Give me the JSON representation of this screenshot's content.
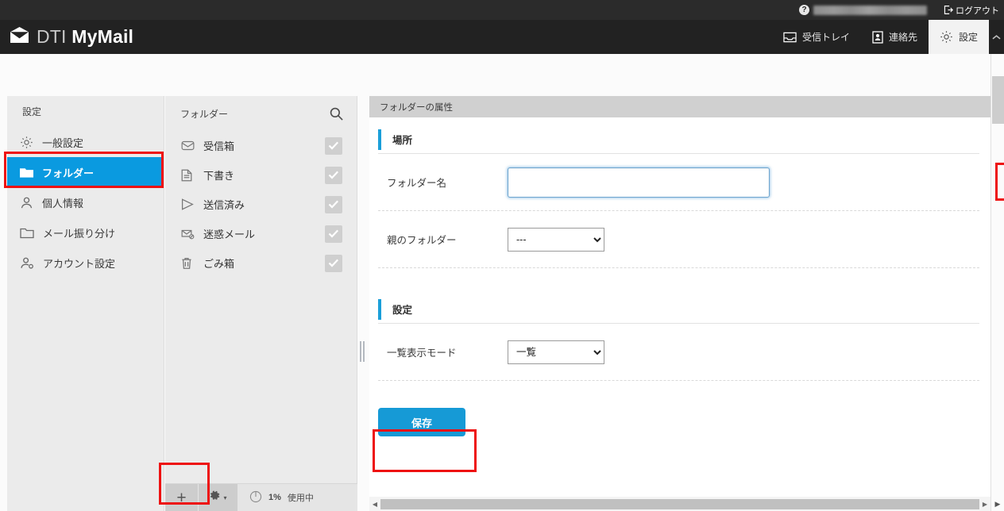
{
  "topbar": {
    "help_icon": "help-circle-icon",
    "user_email": "",
    "logout_label": "ログアウト",
    "logout_icon": "logout-icon"
  },
  "navbar": {
    "brand_icon": "envelope-icon",
    "brand_dti": "DTI",
    "brand_mymail": "MyMail",
    "items": [
      {
        "label": "受信トレイ",
        "icon": "inbox-icon",
        "active": false
      },
      {
        "label": "連絡先",
        "icon": "contacts-icon",
        "active": false
      },
      {
        "label": "設定",
        "icon": "gear-icon",
        "active": true
      }
    ],
    "collapse_icon": "chevron-up-icon"
  },
  "sidebar": {
    "title": "設定",
    "items": [
      {
        "label": "一般設定",
        "icon": "gear-icon",
        "selected": false
      },
      {
        "label": "フォルダー",
        "icon": "folder-filled-icon",
        "selected": true
      },
      {
        "label": "個人情報",
        "icon": "user-icon",
        "selected": false
      },
      {
        "label": "メール振り分け",
        "icon": "folder-outline-icon",
        "selected": false
      },
      {
        "label": "アカウント設定",
        "icon": "user-gear-icon",
        "selected": false
      }
    ]
  },
  "folders": {
    "title": "フォルダー",
    "search_icon": "search-icon",
    "items": [
      {
        "label": "受信箱",
        "icon": "inbox-icon",
        "checked": true
      },
      {
        "label": "下書き",
        "icon": "draft-icon",
        "checked": true
      },
      {
        "label": "送信済み",
        "icon": "sent-icon",
        "checked": true
      },
      {
        "label": "迷惑メール",
        "icon": "spam-icon",
        "checked": true
      },
      {
        "label": "ごみ箱",
        "icon": "trash-icon",
        "checked": true
      }
    ],
    "footer": {
      "add_label": "+",
      "add_icon": "plus-icon",
      "gear_icon": "gear-icon",
      "gear_caret": "▾",
      "usage_icon": "quota-pie-icon",
      "usage_percent": "1%",
      "usage_label": "使用中"
    }
  },
  "main": {
    "panel_title": "フォルダーの属性",
    "sections": [
      {
        "heading": "場所",
        "rows": [
          {
            "label": "フォルダー名",
            "control": "text",
            "value": "",
            "placeholder": ""
          },
          {
            "label": "親のフォルダー",
            "control": "select",
            "value": "---",
            "options": [
              "---"
            ]
          }
        ]
      },
      {
        "heading": "設定",
        "rows": [
          {
            "label": "一覧表示モード",
            "control": "select",
            "value": "一覧",
            "options": [
              "一覧"
            ]
          }
        ]
      }
    ],
    "save_label": "保存",
    "hscroll": {
      "left_arrow": "◀",
      "right_arrow": "▶"
    }
  },
  "scrollbar": {
    "down_arrow": "▶"
  },
  "colors": {
    "accent_blue": "#0a9ae0",
    "button_blue": "#169ad6",
    "section_bar_blue": "#1a9fd9",
    "annotation_red": "#ee1111",
    "navbar_dark": "#222222",
    "topbar_dark": "#2b2b2b",
    "panel_gray": "#ebebeb"
  }
}
